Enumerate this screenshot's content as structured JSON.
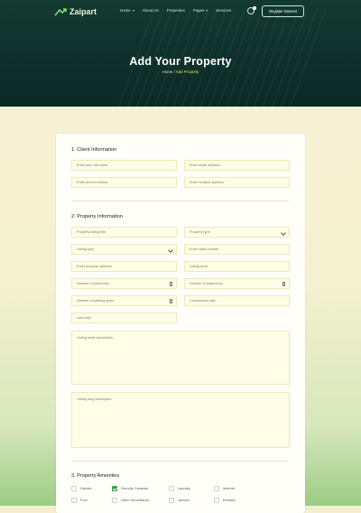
{
  "brand": {
    "name": "Zaipart"
  },
  "nav": {
    "items": [
      {
        "label": "Home",
        "has_caret": true
      },
      {
        "label": "About Us",
        "has_caret": false
      },
      {
        "label": "Properties",
        "has_caret": false
      },
      {
        "label": "Pages",
        "has_caret": true
      },
      {
        "label": "Services",
        "has_caret": false
      }
    ],
    "cta_label": "Register Interest"
  },
  "hero": {
    "title": "Add Your Property",
    "breadcrumb": {
      "home": "Home",
      "separator": " / ",
      "current": "Add Property"
    }
  },
  "form": {
    "section1_title": "1. Client Information",
    "client": {
      "full_name": "Enter your full name",
      "email": "Enter email address",
      "phone": "Enter phone number",
      "location": "Enter location address"
    },
    "section2_title": "2. Property Information",
    "property": {
      "listing_title": "Property listing title",
      "property_type": "Property type",
      "listing_type": "Listing type",
      "state_number": "Enter state number",
      "address": "Enter property address",
      "listing_price": "Listing price",
      "bedrooms": "Number of bedrooms",
      "bathrooms": "Number of bathrooms",
      "parking_spots": "Number of parking spots",
      "construction": "Construction sqft",
      "land": "Land sqft",
      "short_desc": "Listing short description",
      "long_desc": "Listing long description"
    },
    "section3_title": "3. Property Amenities",
    "amenities": [
      {
        "label": "Garden",
        "checked": false
      },
      {
        "label": "Security Cameras",
        "checked": true
      },
      {
        "label": "Laundry",
        "checked": false
      },
      {
        "label": "Internet",
        "checked": false
      },
      {
        "label": "Pool",
        "checked": false
      },
      {
        "label": "Video Surveillance",
        "checked": false
      },
      {
        "label": "Jacuzzi",
        "checked": false
      },
      {
        "label": "Elevator",
        "checked": false
      }
    ]
  },
  "colors": {
    "hero_bg": "#123a31",
    "accent": "#d6e55b",
    "checkbox": "#2fa24e",
    "field_bg": "#fffde5"
  }
}
